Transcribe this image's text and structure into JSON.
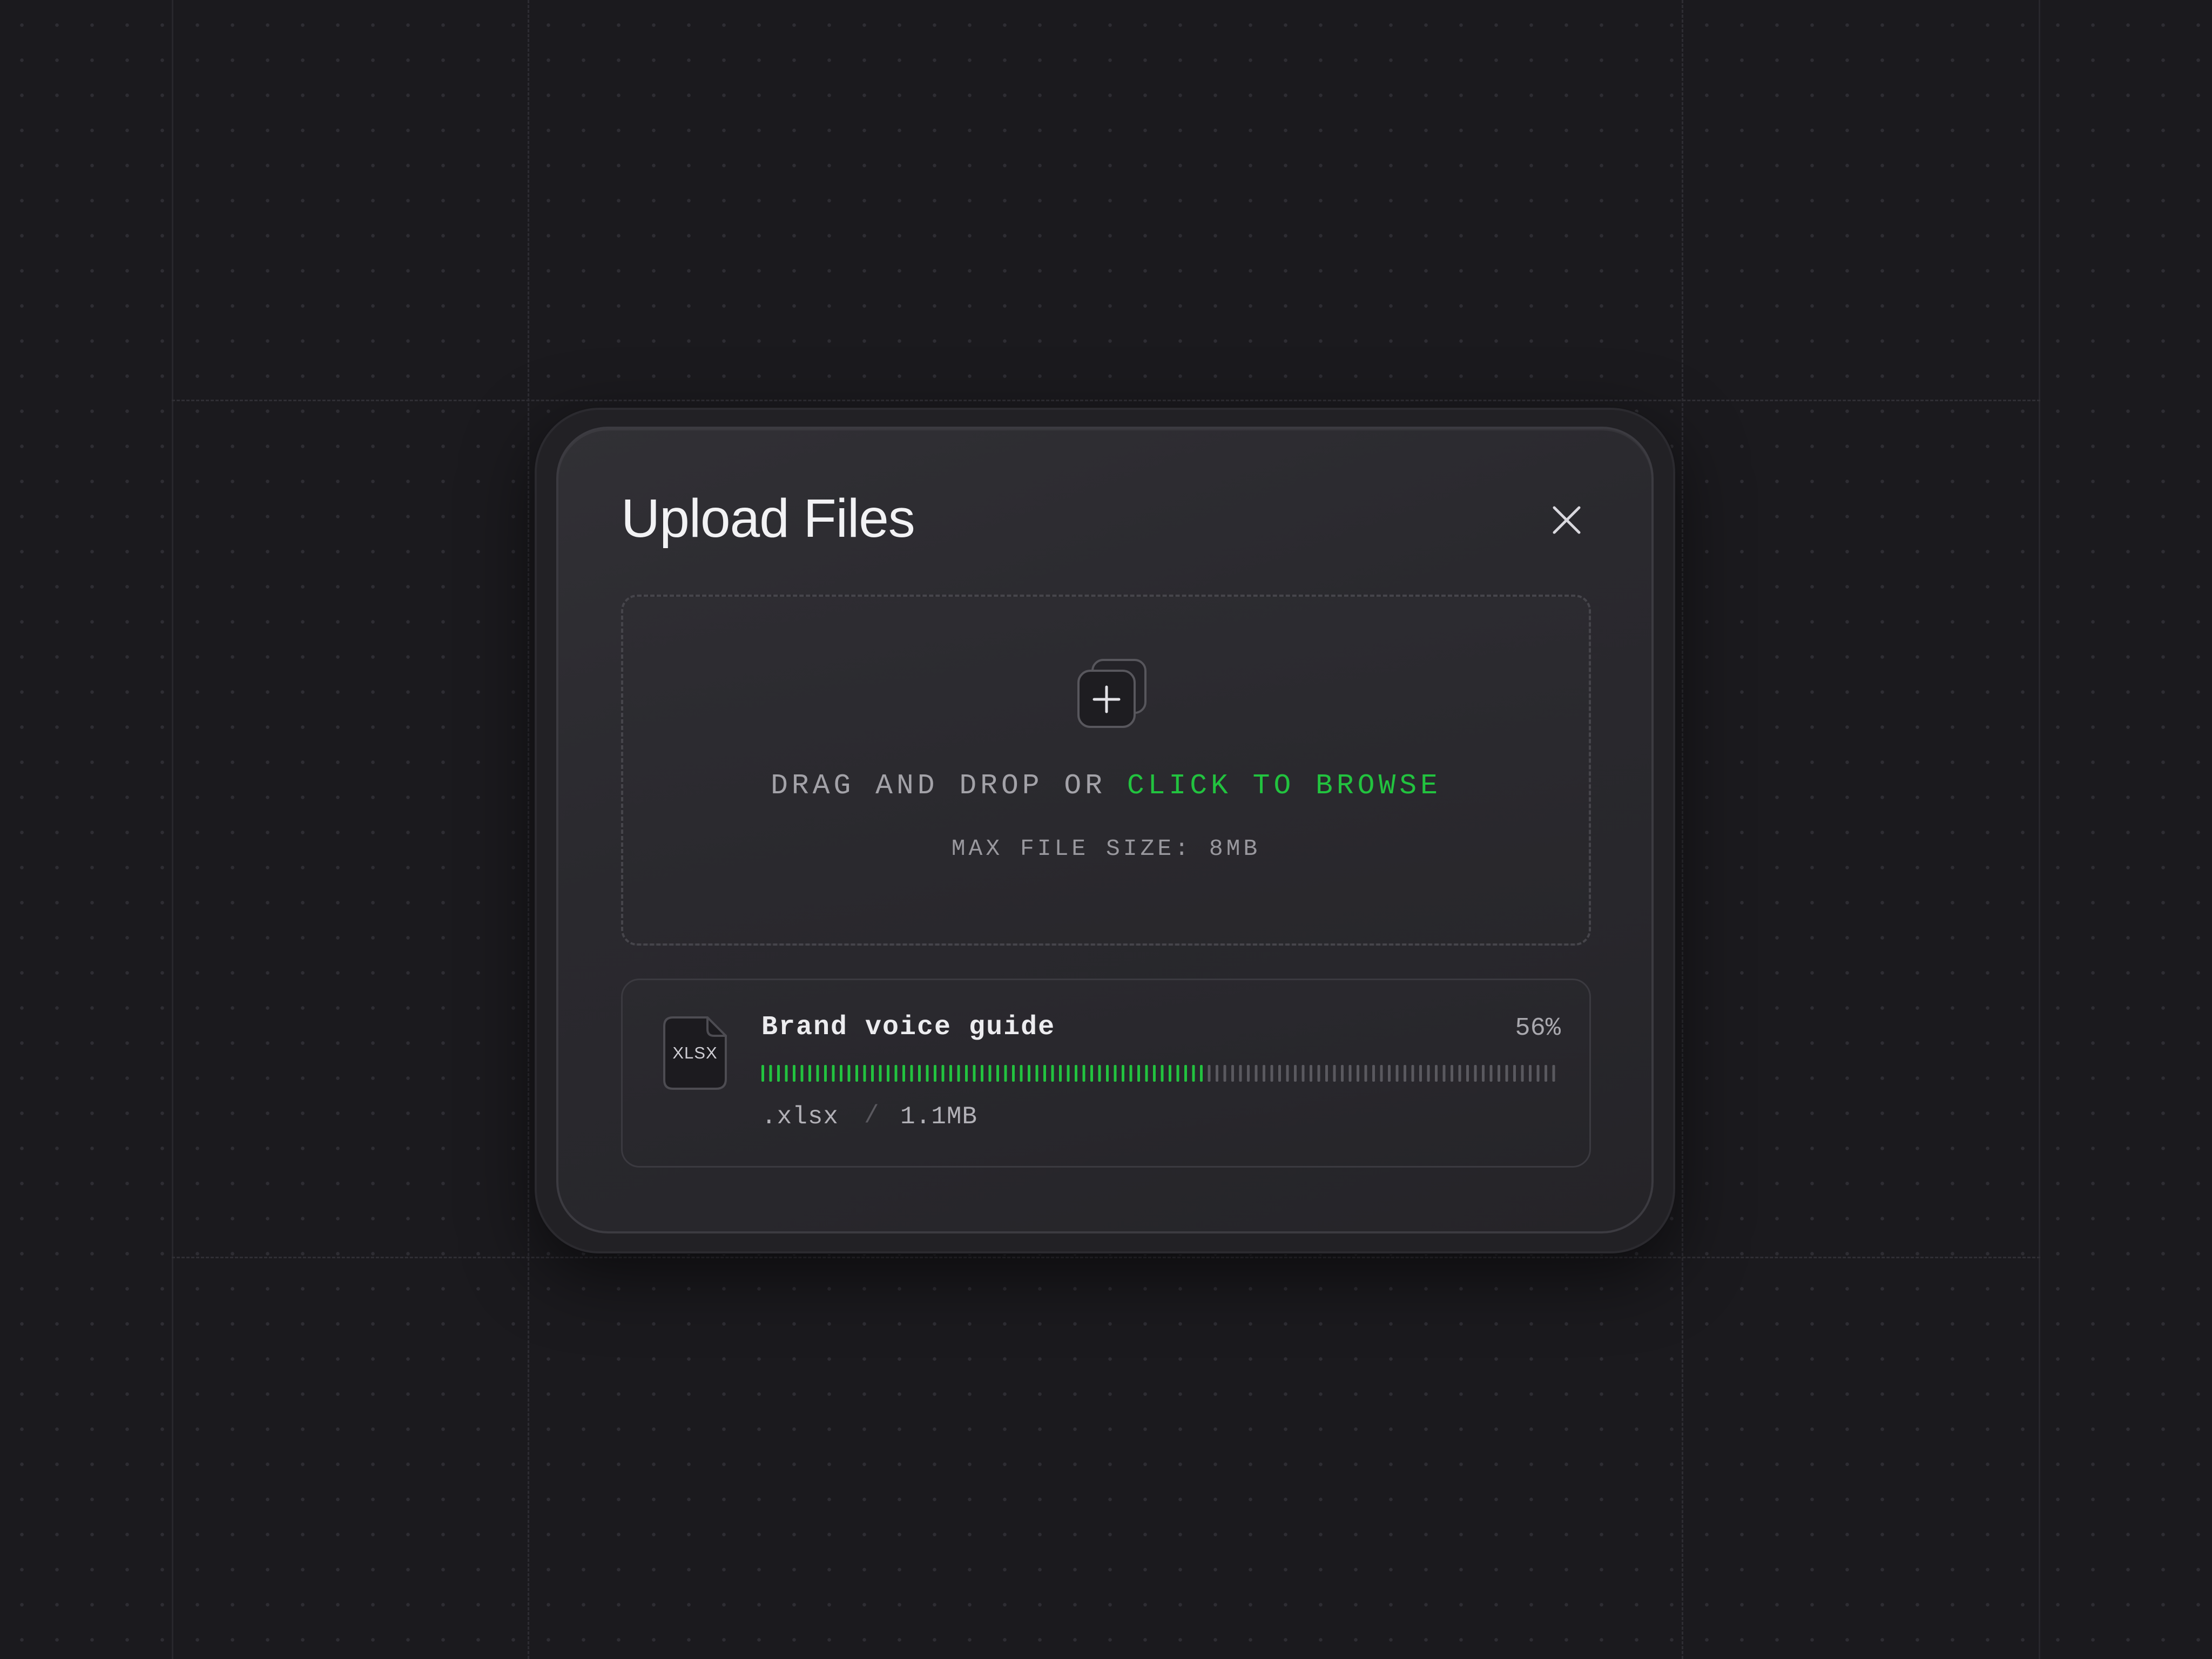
{
  "dialog": {
    "title": "Upload Files",
    "close_icon": "close-icon"
  },
  "dropzone": {
    "prompt_prefix": "DRAG AND DROP OR ",
    "browse_label": "CLICK TO BROWSE",
    "max_size_label": "MAX FILE SIZE: 8MB",
    "icon": "add-files-icon"
  },
  "upload": {
    "file_type_badge": "XLSX",
    "file_name": "Brand voice guide",
    "percent_label": "56%",
    "progress": 0.56,
    "extension": ".xlsx",
    "separator": "/",
    "size": "1.1MB"
  },
  "colors": {
    "accent": "#22c33f",
    "progress_track": "#5a595f",
    "background": "#1b1a1e"
  }
}
